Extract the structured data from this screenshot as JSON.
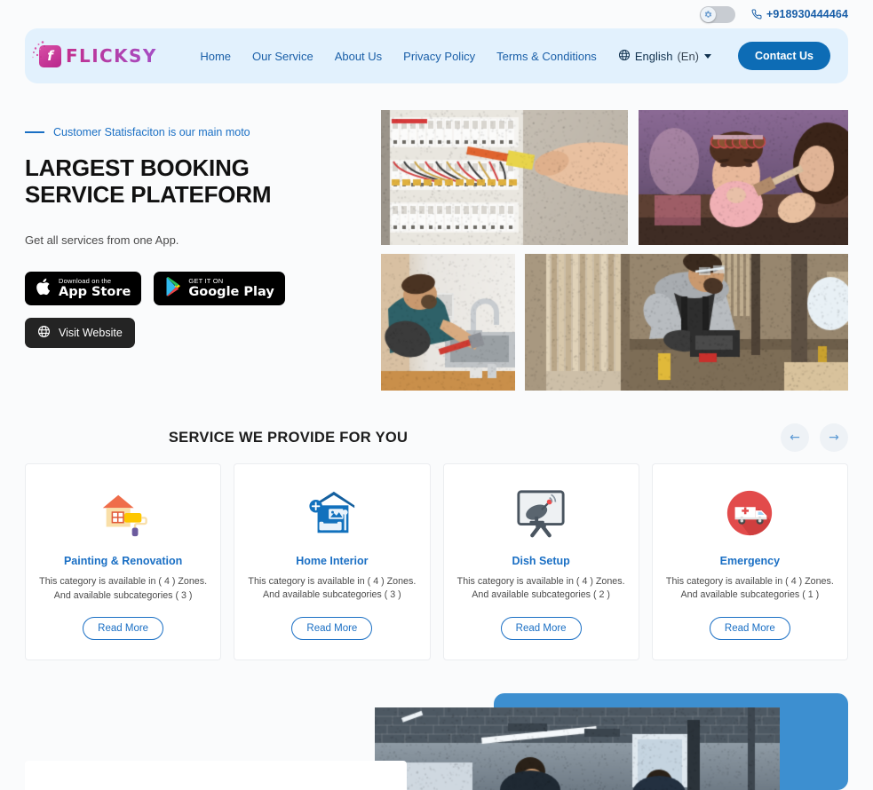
{
  "topbar": {
    "toggle_icon": "gear-icon",
    "toggle_state": "off",
    "phone_icon": "phone-icon",
    "phone": "+918930444464"
  },
  "header": {
    "logo_mark": "f",
    "logo_text": "FLICKSY",
    "nav": [
      {
        "label": "Home"
      },
      {
        "label": "Our Service"
      },
      {
        "label": "About Us"
      },
      {
        "label": "Privacy Policy"
      },
      {
        "label": "Terms & Conditions"
      }
    ],
    "language": {
      "icon": "globe-icon",
      "label": "English",
      "code": "(En)",
      "caret": "chevron-down-icon"
    },
    "contact_label": "Contact Us",
    "bg_color": "#e2f1fd",
    "accent_color": "#0d6cb5"
  },
  "hero": {
    "eyebrow": "Customer Statisfaciton is our main moto",
    "title_line1": "LARGEST BOOKING",
    "title_line2": "SERVICE PLATEFORM",
    "subtitle": "Get all services from one App.",
    "appstore": {
      "small": "Download on the",
      "big": "App Store",
      "icon": "apple-icon"
    },
    "googleplay": {
      "small": "GET IT ON",
      "big": "Google Play",
      "icon": "google-play-icon"
    },
    "visit": {
      "label": "Visit Website",
      "icon": "globe-icon"
    },
    "images": [
      {
        "alt": "electrician-working-on-fuse-box"
      },
      {
        "alt": "salon-makeup-artist-applying-blush"
      },
      {
        "alt": "plumber-fixing-kitchen-sink-faucet"
      },
      {
        "alt": "carpenter-working-in-woodshop"
      }
    ]
  },
  "services": {
    "title": "SERVICE WE PROVIDE FOR YOU",
    "prev_icon": "arrow-left-icon",
    "next_icon": "arrow-right-icon",
    "prev_label": "←",
    "next_label": "→",
    "read_more_label": "Read More",
    "cards": [
      {
        "title": "Painting & Renovation",
        "desc": "This category is available in ( 4 ) Zones. And available subcategories ( 3 )",
        "icon": "house-paint-roller-icon"
      },
      {
        "title": "Home Interior",
        "desc": "This category is available in ( 4 ) Zones. And available subcategories ( 3 )",
        "icon": "home-interior-sofa-icon"
      },
      {
        "title": "Dish Setup",
        "desc": "This category is available in ( 4 ) Zones. And available subcategories ( 2 )",
        "icon": "satellite-dish-tv-icon"
      },
      {
        "title": "Emergency",
        "desc": "This category is available in ( 4 ) Zones. And available subcategories ( 1 )",
        "icon": "ambulance-icon"
      }
    ]
  },
  "bottom": {
    "panel_color": "#3d8fd0",
    "photo_alt": "office-workers-in-open-plan-office"
  }
}
